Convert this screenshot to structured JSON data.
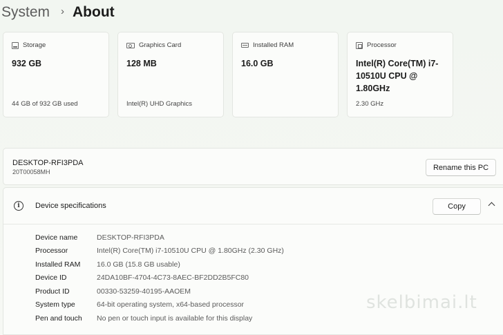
{
  "breadcrumb": {
    "parent": "System",
    "separator": "›",
    "current": "About"
  },
  "cards": [
    {
      "icon": "storage-icon",
      "label": "Storage",
      "value": "932 GB",
      "sub": "44 GB of 932 GB used"
    },
    {
      "icon": "graphics-card-icon",
      "label": "Graphics Card",
      "value": "128 MB",
      "sub": "Intel(R) UHD Graphics"
    },
    {
      "icon": "ram-icon",
      "label": "Installed RAM",
      "value": "16.0 GB",
      "sub": ""
    },
    {
      "icon": "processor-icon",
      "label": "Processor",
      "value": "Intel(R) Core(TM) i7-10510U CPU @ 1.80GHz",
      "sub": "2.30 GHz"
    }
  ],
  "device": {
    "name": "DESKTOP-RFI3PDA",
    "model": "20T00058MH",
    "rename_label": "Rename this PC"
  },
  "specs": {
    "title": "Device specifications",
    "copy_label": "Copy",
    "rows": [
      {
        "label": "Device name",
        "value": "DESKTOP-RFI3PDA"
      },
      {
        "label": "Processor",
        "value": "Intel(R) Core(TM) i7-10510U CPU @ 1.80GHz (2.30 GHz)"
      },
      {
        "label": "Installed RAM",
        "value": "16.0 GB (15.8 GB usable)"
      },
      {
        "label": "Device ID",
        "value": "24DA10BF-4704-4C73-8AEC-BF2DD2B5FC80"
      },
      {
        "label": "Product ID",
        "value": "00330-53259-40195-AAOEM"
      },
      {
        "label": "System type",
        "value": "64-bit operating system, x64-based processor"
      },
      {
        "label": "Pen and touch",
        "value": "No pen or touch input is available for this display"
      }
    ]
  },
  "watermark": "skelbimai.lt"
}
